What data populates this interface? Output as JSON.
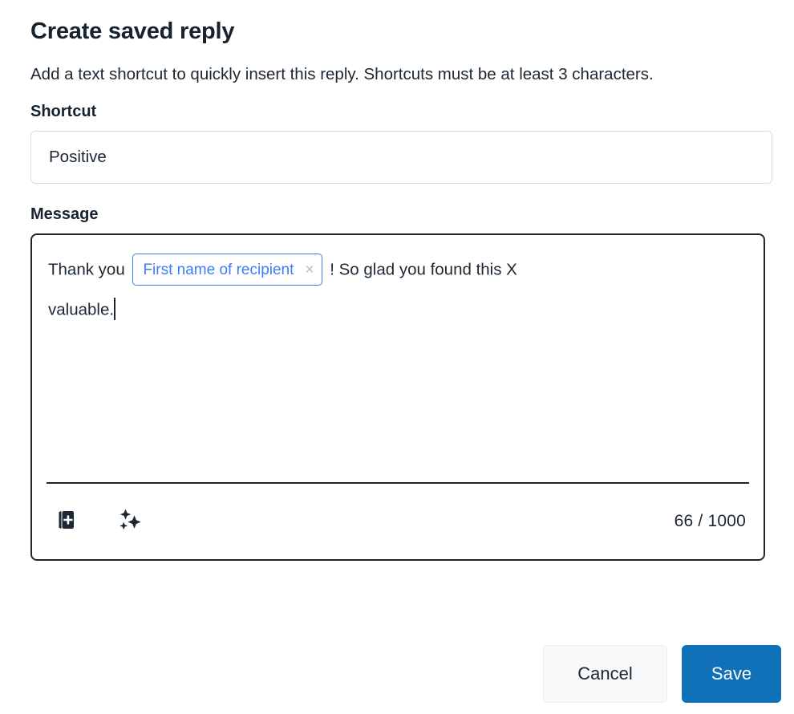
{
  "dialog": {
    "title": "Create saved reply",
    "subtitle": "Add a text shortcut to quickly insert this reply. Shortcuts must be at least 3 characters."
  },
  "shortcut": {
    "label": "Shortcut",
    "value": "Positive",
    "placeholder": ""
  },
  "message": {
    "label": "Message",
    "text_before": "Thank you",
    "chip_label": "First name of recipient",
    "chip_remove_glyph": "×",
    "text_after": "! So glad you found this X valuable.",
    "line1_after": "! So glad you found this X",
    "line2": "valuable.",
    "char_count": "66 / 1000",
    "toolbar": {
      "insert_placeholder_icon": "insert-placeholder-icon",
      "ai_assist_icon": "ai-sparkle-icon"
    }
  },
  "actions": {
    "cancel_label": "Cancel",
    "save_label": "Save"
  },
  "colors": {
    "accent_blue": "#1070b8",
    "chip_blue": "#3b7ef5",
    "text_dark": "#1b2733",
    "border_light": "#d8dcde"
  }
}
